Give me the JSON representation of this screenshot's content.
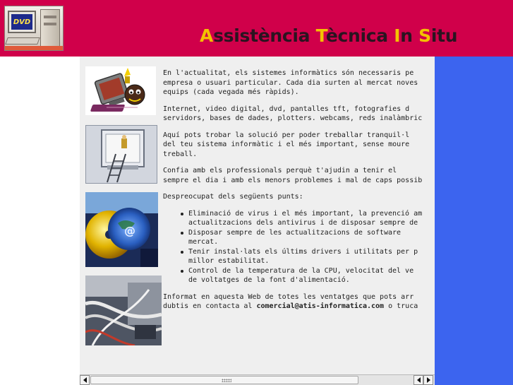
{
  "header": {
    "logo_text": "DVD",
    "title_parts": [
      {
        "cap": "A",
        "rest": "ssistència "
      },
      {
        "cap": "T",
        "rest": "ècnica "
      },
      {
        "cap": "I",
        "rest": "n "
      },
      {
        "cap": "S",
        "rest": "itu"
      }
    ]
  },
  "colors": {
    "header_bg": "#d0004a",
    "title_highlight": "#f3c200",
    "content_bg": "#efefef",
    "right_bar": "#3c64ef"
  },
  "content": {
    "paragraphs": [
      [
        "En l'actualitat, els sistemes informàtics són necessaris pe",
        "empresa o usuari particular. Cada dia surten al mercat noves",
        "equips (cada vegada més ràpids)."
      ],
      [
        "Internet, video digital, dvd, pantalles tft, fotografies d",
        "servidors, bases de dades, plotters. webcams, reds inalàmbric"
      ],
      [
        "Aquí pots trobar la solució per poder treballar tranquil·l",
        "del teu sistema informàtic i el més important, sense moure",
        "treball."
      ],
      [
        "Confia amb els professionals perquè t'ajudin a tenir el",
        "sempre el dia i amb els menors problemes i mal de caps possib"
      ]
    ],
    "list_intro": "Despreocupat dels següents punts:",
    "list_items": [
      [
        "Eliminació de virus i el més important, la prevenció am",
        "actualitzacions dels antivirus i de disposar sempre de"
      ],
      [
        "Disposar sempre de les actualitzacions de software",
        "mercat."
      ],
      [
        "Tenir instal·lats els últims drivers i utilitats per p",
        "millor estabilitat."
      ],
      [
        "Control de la temperatura de la CPU, velocitat del ve",
        "de voltatges de la font d'alimentació."
      ]
    ],
    "closing_line1": "Informat en aquesta Web de totes les ventatges que pots arr",
    "closing_line2_before": "dubtis en contacta al ",
    "closing_email": "comercial@atis-informatica.com",
    "closing_line2_after": " o truca"
  },
  "icons": {
    "scroll_left": "arrow-left-icon",
    "scroll_right": "arrow-right-icon"
  }
}
